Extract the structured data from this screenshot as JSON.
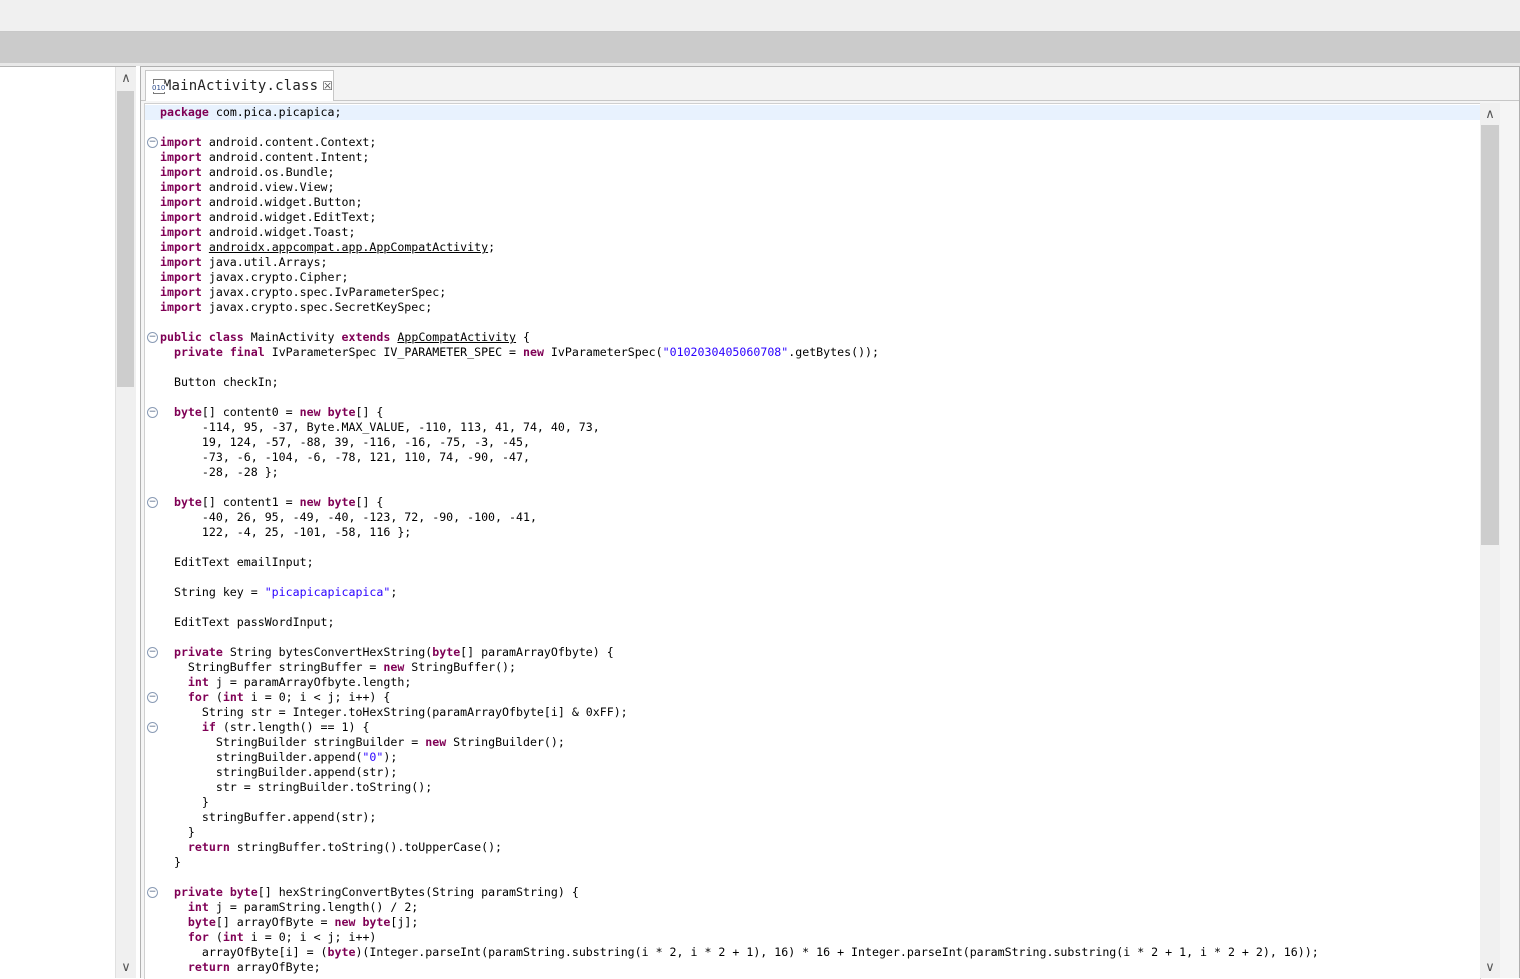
{
  "editor": {
    "tab_title": "MainActivity.class",
    "tab_close": "☒",
    "class_icon_label": "010"
  },
  "scroll": {
    "up": "∧",
    "down": "∨"
  },
  "code": {
    "lines": [
      {
        "fold": false,
        "hl": true,
        "segs": [
          {
            "t": "package",
            "c": "kw"
          },
          {
            "t": " com.pica.picapica;"
          }
        ]
      },
      {
        "fold": false,
        "segs": []
      },
      {
        "fold": true,
        "segs": [
          {
            "t": "import",
            "c": "kw"
          },
          {
            "t": " android.content.Context;"
          }
        ]
      },
      {
        "fold": false,
        "segs": [
          {
            "t": "import",
            "c": "kw"
          },
          {
            "t": " android.content.Intent;"
          }
        ]
      },
      {
        "fold": false,
        "segs": [
          {
            "t": "import",
            "c": "kw"
          },
          {
            "t": " android.os.Bundle;"
          }
        ]
      },
      {
        "fold": false,
        "segs": [
          {
            "t": "import",
            "c": "kw"
          },
          {
            "t": " android.view.View;"
          }
        ]
      },
      {
        "fold": false,
        "segs": [
          {
            "t": "import",
            "c": "kw"
          },
          {
            "t": " android.widget.Button;"
          }
        ]
      },
      {
        "fold": false,
        "segs": [
          {
            "t": "import",
            "c": "kw"
          },
          {
            "t": " android.widget.EditText;"
          }
        ]
      },
      {
        "fold": false,
        "segs": [
          {
            "t": "import",
            "c": "kw"
          },
          {
            "t": " android.widget.Toast;"
          }
        ]
      },
      {
        "fold": false,
        "segs": [
          {
            "t": "import",
            "c": "kw"
          },
          {
            "t": " "
          },
          {
            "t": "androidx.appcompat.app.AppCompatActivity",
            "c": "ul"
          },
          {
            "t": ";"
          }
        ]
      },
      {
        "fold": false,
        "segs": [
          {
            "t": "import",
            "c": "kw"
          },
          {
            "t": " java.util.Arrays;"
          }
        ]
      },
      {
        "fold": false,
        "segs": [
          {
            "t": "import",
            "c": "kw"
          },
          {
            "t": " javax.crypto.Cipher;"
          }
        ]
      },
      {
        "fold": false,
        "segs": [
          {
            "t": "import",
            "c": "kw"
          },
          {
            "t": " javax.crypto.spec.IvParameterSpec;"
          }
        ]
      },
      {
        "fold": false,
        "segs": [
          {
            "t": "import",
            "c": "kw"
          },
          {
            "t": " javax.crypto.spec.SecretKeySpec;"
          }
        ]
      },
      {
        "fold": false,
        "segs": []
      },
      {
        "fold": true,
        "segs": [
          {
            "t": "public",
            "c": "kw"
          },
          {
            "t": " "
          },
          {
            "t": "class",
            "c": "kw"
          },
          {
            "t": " MainActivity "
          },
          {
            "t": "extends",
            "c": "kw"
          },
          {
            "t": " "
          },
          {
            "t": "AppCompatActivity",
            "c": "ul"
          },
          {
            "t": " {"
          }
        ]
      },
      {
        "fold": false,
        "segs": [
          {
            "t": "  "
          },
          {
            "t": "private",
            "c": "kw"
          },
          {
            "t": " "
          },
          {
            "t": "final",
            "c": "kw"
          },
          {
            "t": " IvParameterSpec IV_PARAMETER_SPEC = "
          },
          {
            "t": "new",
            "c": "kw"
          },
          {
            "t": " IvParameterSpec("
          },
          {
            "t": "\"0102030405060708\"",
            "c": "str"
          },
          {
            "t": ".getBytes());"
          }
        ]
      },
      {
        "fold": false,
        "segs": []
      },
      {
        "fold": false,
        "segs": [
          {
            "t": "  Button checkIn;"
          }
        ]
      },
      {
        "fold": false,
        "segs": []
      },
      {
        "fold": true,
        "segs": [
          {
            "t": "  "
          },
          {
            "t": "byte",
            "c": "kw"
          },
          {
            "t": "[] content0 = "
          },
          {
            "t": "new",
            "c": "kw"
          },
          {
            "t": " "
          },
          {
            "t": "byte",
            "c": "kw"
          },
          {
            "t": "[] {"
          }
        ]
      },
      {
        "fold": false,
        "segs": [
          {
            "t": "      -114, 95, -37, Byte.MAX_VALUE, -110, 113, 41, 74, 40, 73,"
          }
        ]
      },
      {
        "fold": false,
        "segs": [
          {
            "t": "      19, 124, -57, -88, 39, -116, -16, -75, -3, -45,"
          }
        ]
      },
      {
        "fold": false,
        "segs": [
          {
            "t": "      -73, -6, -104, -6, -78, 121, 110, 74, -90, -47,"
          }
        ]
      },
      {
        "fold": false,
        "segs": [
          {
            "t": "      -28, -28 };"
          }
        ]
      },
      {
        "fold": false,
        "segs": []
      },
      {
        "fold": true,
        "segs": [
          {
            "t": "  "
          },
          {
            "t": "byte",
            "c": "kw"
          },
          {
            "t": "[] content1 = "
          },
          {
            "t": "new",
            "c": "kw"
          },
          {
            "t": " "
          },
          {
            "t": "byte",
            "c": "kw"
          },
          {
            "t": "[] {"
          }
        ]
      },
      {
        "fold": false,
        "segs": [
          {
            "t": "      -40, 26, 95, -49, -40, -123, 72, -90, -100, -41,"
          }
        ]
      },
      {
        "fold": false,
        "segs": [
          {
            "t": "      122, -4, 25, -101, -58, 116 };"
          }
        ]
      },
      {
        "fold": false,
        "segs": []
      },
      {
        "fold": false,
        "segs": [
          {
            "t": "  EditText emailInput;"
          }
        ]
      },
      {
        "fold": false,
        "segs": []
      },
      {
        "fold": false,
        "segs": [
          {
            "t": "  String key = "
          },
          {
            "t": "\"picapicapicapica\"",
            "c": "str"
          },
          {
            "t": ";"
          }
        ]
      },
      {
        "fold": false,
        "segs": []
      },
      {
        "fold": false,
        "segs": [
          {
            "t": "  EditText passWordInput;"
          }
        ]
      },
      {
        "fold": false,
        "segs": []
      },
      {
        "fold": true,
        "segs": [
          {
            "t": "  "
          },
          {
            "t": "private",
            "c": "kw"
          },
          {
            "t": " String bytesConvertHexString("
          },
          {
            "t": "byte",
            "c": "kw"
          },
          {
            "t": "[] paramArrayOfbyte) {"
          }
        ]
      },
      {
        "fold": false,
        "segs": [
          {
            "t": "    StringBuffer stringBuffer = "
          },
          {
            "t": "new",
            "c": "kw"
          },
          {
            "t": " StringBuffer();"
          }
        ]
      },
      {
        "fold": false,
        "segs": [
          {
            "t": "    "
          },
          {
            "t": "int",
            "c": "kw"
          },
          {
            "t": " j = paramArrayOfbyte.length;"
          }
        ]
      },
      {
        "fold": true,
        "segs": [
          {
            "t": "    "
          },
          {
            "t": "for",
            "c": "kw"
          },
          {
            "t": " ("
          },
          {
            "t": "int",
            "c": "kw"
          },
          {
            "t": " i = 0; i < j; i++) {"
          }
        ]
      },
      {
        "fold": false,
        "segs": [
          {
            "t": "      String str = Integer.toHexString(paramArrayOfbyte[i] & 0xFF);"
          }
        ]
      },
      {
        "fold": true,
        "segs": [
          {
            "t": "      "
          },
          {
            "t": "if",
            "c": "kw"
          },
          {
            "t": " (str.length() == 1) {"
          }
        ]
      },
      {
        "fold": false,
        "segs": [
          {
            "t": "        StringBuilder stringBuilder = "
          },
          {
            "t": "new",
            "c": "kw"
          },
          {
            "t": " StringBuilder();"
          }
        ]
      },
      {
        "fold": false,
        "segs": [
          {
            "t": "        stringBuilder.append("
          },
          {
            "t": "\"0\"",
            "c": "str"
          },
          {
            "t": ");"
          }
        ]
      },
      {
        "fold": false,
        "segs": [
          {
            "t": "        stringBuilder.append(str);"
          }
        ]
      },
      {
        "fold": false,
        "segs": [
          {
            "t": "        str = stringBuilder.toString();"
          }
        ]
      },
      {
        "fold": false,
        "segs": [
          {
            "t": "      }"
          }
        ]
      },
      {
        "fold": false,
        "segs": [
          {
            "t": "      stringBuffer.append(str);"
          }
        ]
      },
      {
        "fold": false,
        "segs": [
          {
            "t": "    }"
          }
        ]
      },
      {
        "fold": false,
        "segs": [
          {
            "t": "    "
          },
          {
            "t": "return",
            "c": "kw"
          },
          {
            "t": " stringBuffer.toString().toUpperCase();"
          }
        ]
      },
      {
        "fold": false,
        "segs": [
          {
            "t": "  }"
          }
        ]
      },
      {
        "fold": false,
        "segs": []
      },
      {
        "fold": true,
        "segs": [
          {
            "t": "  "
          },
          {
            "t": "private",
            "c": "kw"
          },
          {
            "t": " "
          },
          {
            "t": "byte",
            "c": "kw"
          },
          {
            "t": "[] hexStringConvertBytes(String paramString) {"
          }
        ]
      },
      {
        "fold": false,
        "segs": [
          {
            "t": "    "
          },
          {
            "t": "int",
            "c": "kw"
          },
          {
            "t": " j = paramString.length() / 2;"
          }
        ]
      },
      {
        "fold": false,
        "segs": [
          {
            "t": "    "
          },
          {
            "t": "byte",
            "c": "kw"
          },
          {
            "t": "[] arrayOfByte = "
          },
          {
            "t": "new",
            "c": "kw"
          },
          {
            "t": " "
          },
          {
            "t": "byte",
            "c": "kw"
          },
          {
            "t": "[j];"
          }
        ]
      },
      {
        "fold": false,
        "segs": [
          {
            "t": "    "
          },
          {
            "t": "for",
            "c": "kw"
          },
          {
            "t": " ("
          },
          {
            "t": "int",
            "c": "kw"
          },
          {
            "t": " i = 0; i < j; i++)"
          }
        ]
      },
      {
        "fold": false,
        "segs": [
          {
            "t": "      arrayOfByte[i] = ("
          },
          {
            "t": "byte",
            "c": "kw"
          },
          {
            "t": ")(Integer.parseInt(paramString.substring(i * 2, i * 2 + 1), 16) * 16 + Integer.parseInt(paramString.substring(i * 2 + 1, i * 2 + 2), 16));"
          }
        ]
      },
      {
        "fold": false,
        "segs": [
          {
            "t": "    "
          },
          {
            "t": "return",
            "c": "kw"
          },
          {
            "t": " arrayOfByte;"
          }
        ]
      }
    ]
  }
}
